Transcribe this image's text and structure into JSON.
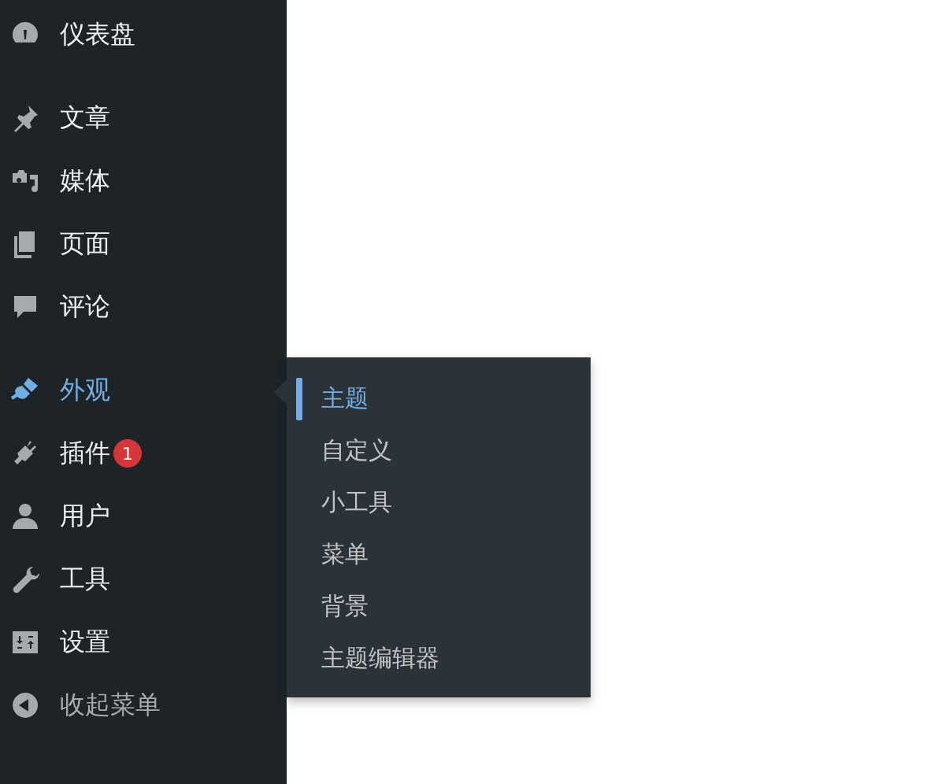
{
  "sidebar": {
    "groups": [
      [
        {
          "label": "仪表盘",
          "kind": "menu",
          "selected": false
        }
      ],
      [
        {
          "label": "文章",
          "kind": "menu",
          "selected": false
        },
        {
          "label": "媒体",
          "kind": "menu",
          "selected": false
        },
        {
          "label": "页面",
          "kind": "menu",
          "selected": false
        },
        {
          "label": "评论",
          "kind": "menu",
          "selected": false
        }
      ],
      [
        {
          "label": "外观",
          "kind": "menu",
          "selected": true
        },
        {
          "label": "插件",
          "kind": "menu",
          "selected": false,
          "badge": "1"
        },
        {
          "label": "用户",
          "kind": "menu",
          "selected": false
        },
        {
          "label": "工具",
          "kind": "menu",
          "selected": false
        },
        {
          "label": "设置",
          "kind": "menu",
          "selected": false
        },
        {
          "label": "收起菜单",
          "kind": "collapse",
          "selected": false
        }
      ]
    ]
  },
  "flyout": {
    "items": [
      {
        "label": "主题",
        "selected": true
      },
      {
        "label": "自定义",
        "selected": false
      },
      {
        "label": "小工具",
        "selected": false
      },
      {
        "label": "菜单",
        "selected": false
      },
      {
        "label": "背景",
        "selected": false
      },
      {
        "label": "主题编辑器",
        "selected": false
      }
    ]
  }
}
